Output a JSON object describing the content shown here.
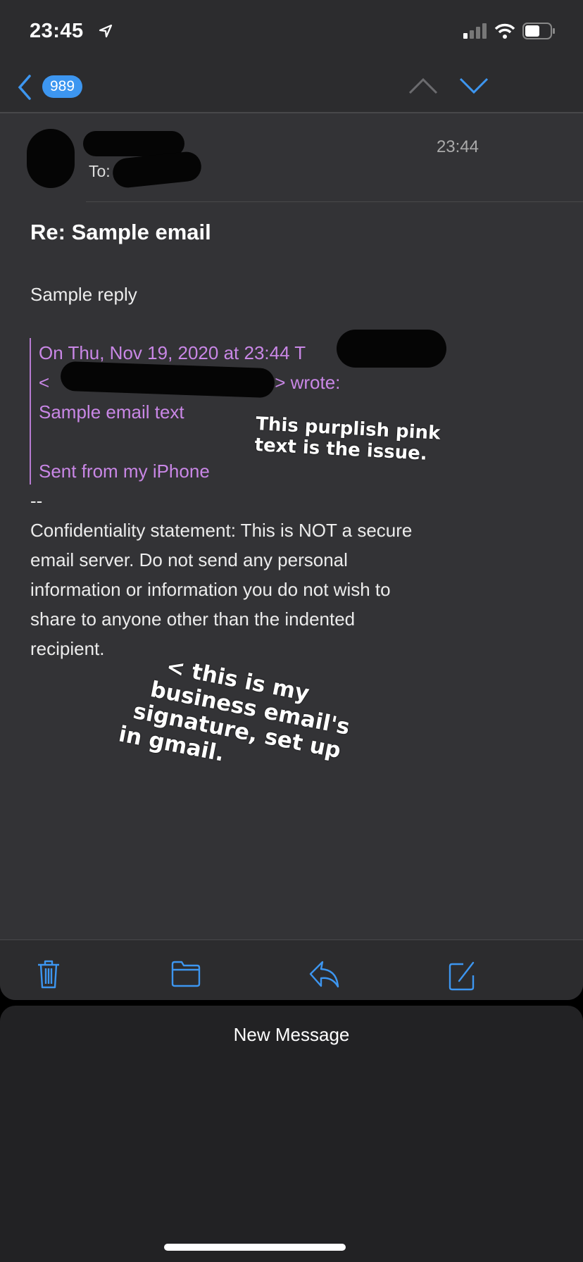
{
  "status_bar": {
    "time": "23:45",
    "icons": [
      "location-arrow-icon",
      "signal-icon",
      "wifi-icon",
      "battery-icon"
    ]
  },
  "nav": {
    "unread_count": "989",
    "icons": [
      "back-chevron-icon",
      "previous-message-icon",
      "next-message-icon"
    ]
  },
  "message": {
    "to_label": "To:",
    "time": "23:44",
    "subject": "Re: Sample email",
    "reply": "Sample reply",
    "quote": {
      "line1": "On Thu, Nov 19, 2020 at 23:44 T",
      "line2_prefix": "<",
      "line2_suffix": "> wrote:",
      "body": "Sample email text",
      "signature": "Sent from my iPhone"
    },
    "sig_separator": "--",
    "confidentiality": [
      "Confidentiality statement: This is NOT a secure",
      "email server. Do not send any personal",
      "information or information you do not wish to",
      "share to anyone other than the indented",
      "recipient."
    ]
  },
  "annotations": {
    "note1": [
      "This purplish pink",
      "text is the issue."
    ],
    "note2": [
      "< this is my",
      "business email's",
      "signature, set up",
      "in gmail."
    ]
  },
  "colors": {
    "accent": "#3d96f0",
    "quote": "#c987e6",
    "background": "#333336"
  },
  "toolbar": {
    "icons": [
      "trash-icon",
      "folder-icon",
      "reply-icon",
      "compose-icon"
    ]
  },
  "sheet": {
    "title": "New Message"
  }
}
